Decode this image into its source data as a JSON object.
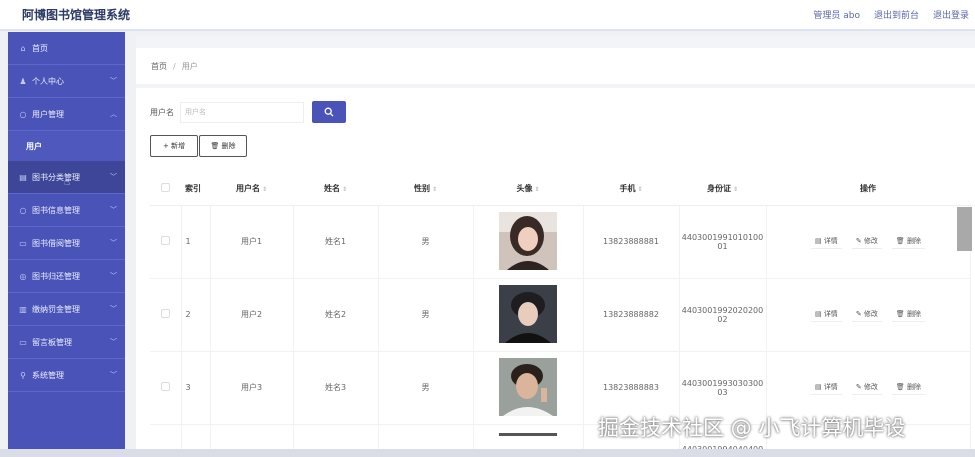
{
  "header": {
    "title": "阿博图书馆管理系统",
    "links": [
      "管理员 abo",
      "退出到前台",
      "退出登录"
    ]
  },
  "sidebar": {
    "items": [
      {
        "label": "首页",
        "icon": "home-icon",
        "glyph": "⌂",
        "has_chevron": false
      },
      {
        "label": "个人中心",
        "icon": "user-icon",
        "glyph": "♟",
        "has_chevron": true
      },
      {
        "label": "用户管理",
        "icon": "users-icon",
        "glyph": "○",
        "has_chevron": true,
        "expanded": true
      },
      {
        "label": "用户",
        "sub": true
      },
      {
        "label": "图书分类管理",
        "icon": "book-category-icon",
        "glyph": "▤",
        "has_chevron": true
      },
      {
        "label": "图书信息管理",
        "icon": "book-info-icon",
        "glyph": "○",
        "has_chevron": true
      },
      {
        "label": "图书借阅管理",
        "icon": "borrow-icon",
        "glyph": "▭",
        "has_chevron": true
      },
      {
        "label": "图书归还管理",
        "icon": "return-icon",
        "glyph": "◎",
        "has_chevron": true
      },
      {
        "label": "缴纳罚金管理",
        "icon": "fine-icon",
        "glyph": "▥",
        "has_chevron": true
      },
      {
        "label": "留言板管理",
        "icon": "message-icon",
        "glyph": "▭",
        "has_chevron": true
      },
      {
        "label": "系统管理",
        "icon": "settings-icon",
        "glyph": "⚲",
        "has_chevron": true
      }
    ]
  },
  "breadcrumb": {
    "home": "首页",
    "sep": "/",
    "current": "用户"
  },
  "search": {
    "label": "用户名",
    "placeholder": "用户名",
    "button_icon": "search-icon"
  },
  "actions": {
    "add_label": "+ 新增",
    "delete_label": "🗑 删除"
  },
  "table": {
    "headers": {
      "index": "索引",
      "username": "用户名",
      "name": "姓名",
      "gender": "性别",
      "avatar": "头像",
      "phone": "手机",
      "idcard": "身份证",
      "ops": "操作"
    },
    "rows": [
      {
        "index": "1",
        "username": "用户1",
        "name": "姓名1",
        "gender": "男",
        "phone": "13823888881",
        "idcard_line1": "4403001991010100",
        "idcard_line2": "01"
      },
      {
        "index": "2",
        "username": "用户2",
        "name": "姓名2",
        "gender": "男",
        "phone": "13823888882",
        "idcard_line1": "4403001992020200",
        "idcard_line2": "02"
      },
      {
        "index": "3",
        "username": "用户3",
        "name": "姓名3",
        "gender": "男",
        "phone": "13823888883",
        "idcard_line1": "4403001993030300",
        "idcard_line2": "03"
      }
    ],
    "partial_idcard": "4403001994040400",
    "ops": {
      "detail": "详情",
      "edit": "修改",
      "delete": "删除"
    }
  },
  "watermark": "掘金技术社区 @ 小飞计算机毕设",
  "colors": {
    "accent": "#4a54b8",
    "sidebar": "#4a54b8"
  }
}
